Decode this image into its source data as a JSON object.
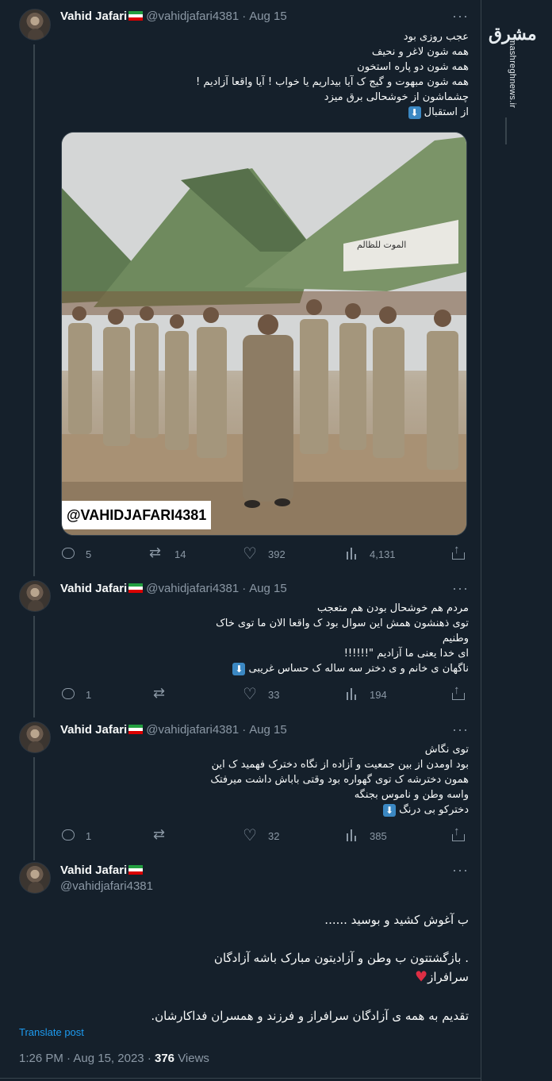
{
  "watermark": {
    "logo": "مشرق",
    "site": "mashreghnews.ir"
  },
  "tweets": [
    {
      "name": "Vahid Jafari",
      "handle": "@vahidjafari4381",
      "separator": "·",
      "date": "Aug 15",
      "more": "···",
      "lines": [
        "عجب روزی بود",
        "همه شون لاغر و نحیف",
        "همه شون دو پاره استخون",
        "همه شون مبهوت و گیج ک آیا بیداریم یا خواب ! آیا واقعا آزادیم !",
        "چشماشون از خوشحالی برق میزد",
        "از استقبال"
      ],
      "image_watermark": "@VAHIDJAFARI4381",
      "image_banner": "الموت للظالم",
      "stats": {
        "replies": "5",
        "retweets": "14",
        "likes": "392",
        "views": "4,131"
      }
    },
    {
      "name": "Vahid Jafari",
      "handle": "@vahidjafari4381",
      "separator": "·",
      "date": "Aug 15",
      "more": "···",
      "lines": [
        "مردم هم خوشحال بودن هم متعجب",
        "توی ذهنشون همش این سوال بود ک واقعا الان ما توی خاک",
        "وطنیم",
        "ای خدا یعنی ما آزادیم \"!!!!!!",
        "ناگهان ی خانم و ی دختر سه ساله ک حساس غریبی"
      ],
      "stats": {
        "replies": "1",
        "retweets": "",
        "likes": "33",
        "views": "194"
      }
    },
    {
      "name": "Vahid Jafari",
      "handle": "@vahidjafari4381",
      "separator": "·",
      "date": "Aug 15",
      "more": "···",
      "lines": [
        "توی نگاش",
        "بود اومدن از بین جمعیت و آزاده از نگاه دخترک فهمید ک این",
        "همون دخترشه ک توی گهواره بود وقتی باباش داشت میرفتک",
        "واسه وطن و ناموس بجنگه",
        "دخترکو بی درنگ"
      ],
      "stats": {
        "replies": "1",
        "retweets": "",
        "likes": "32",
        "views": "385"
      }
    },
    {
      "name": "Vahid Jafari",
      "handle": "@vahidjafari4381",
      "more": "···",
      "lines": [
        "ب آغوش کشید و بوسید ......",
        "",
        ". بازگشتتون ب وطن و آزادیتون مبارک باشه آزادگان",
        "سرافراز",
        "",
        "تقدیم به همه ی آزادگان سرافراز و فرزند و همسران فداکارشان."
      ],
      "translate": "Translate post",
      "time": "1:26 PM",
      "full_date": "Aug 15, 2023",
      "views_count": "376",
      "views_label": "Views"
    }
  ]
}
